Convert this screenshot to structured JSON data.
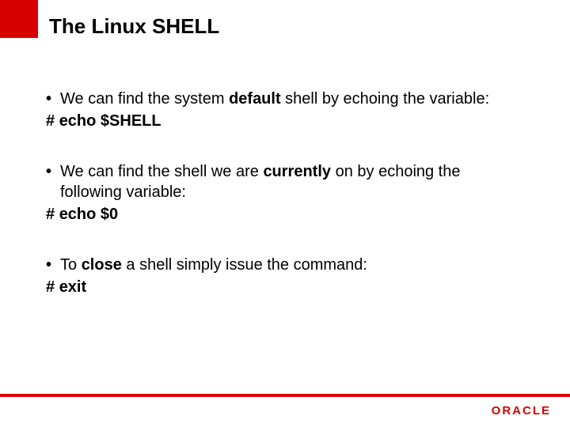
{
  "title": "The Linux SHELL",
  "bullets": [
    {
      "text_before": "We can find the system ",
      "text_bold": "default",
      "text_after": " shell by echoing the variable:",
      "command": "echo $SHELL"
    },
    {
      "text_before": " We can find the shell we are ",
      "text_bold": "currently",
      "text_after": " on by echoing the following variable:",
      "command": "echo $0"
    },
    {
      "text_before": "To ",
      "text_bold": "close",
      "text_after": " a shell simply issue the command:",
      "command": "exit"
    }
  ],
  "hash": "#  ",
  "dot": "•",
  "logo": "ORACLE"
}
